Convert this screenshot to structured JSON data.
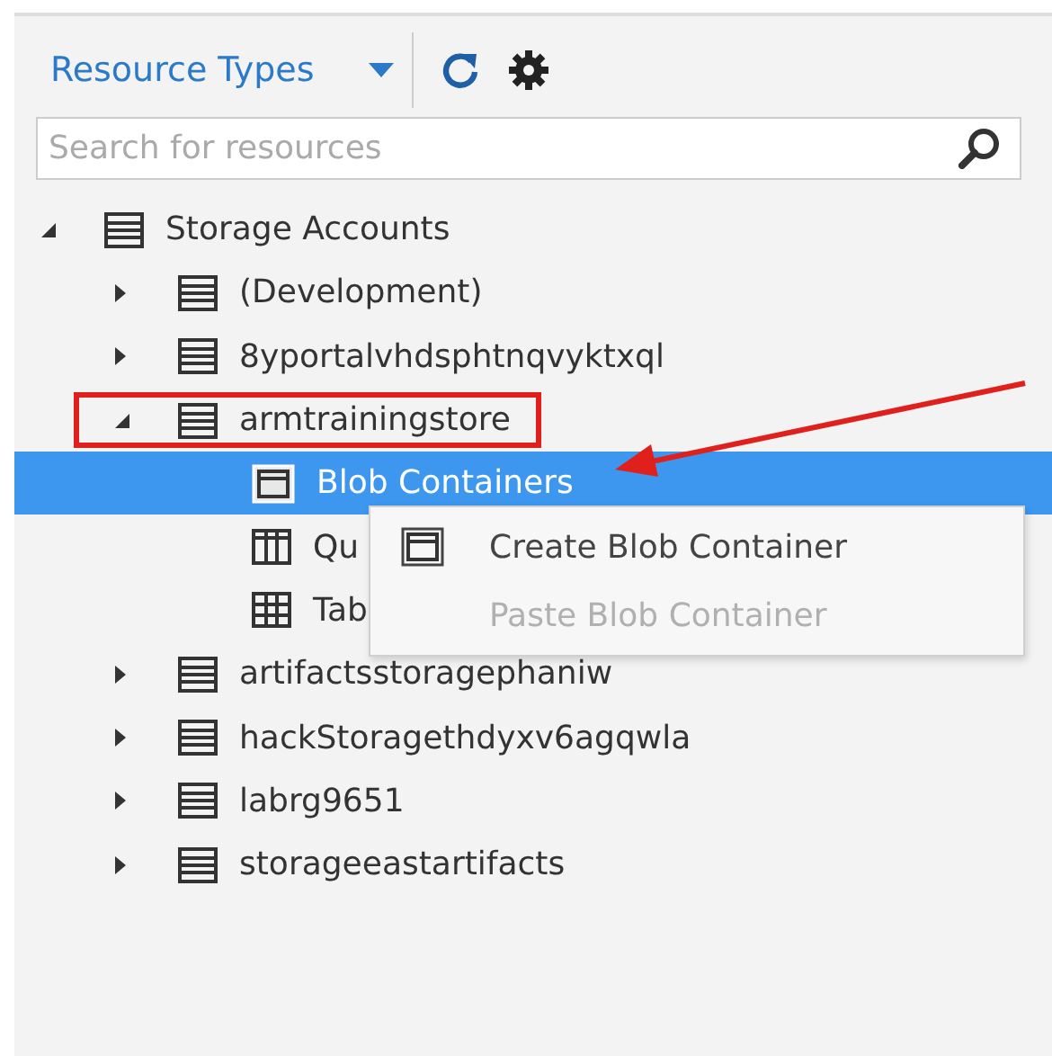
{
  "toolbar": {
    "dropdown": "Resource Types"
  },
  "search": {
    "placeholder": "Search for resources"
  },
  "tree": [
    {
      "label": "Storage Accounts",
      "kind": "account",
      "expanded": true,
      "selected": false,
      "children": [
        {
          "label": "(Development)",
          "kind": "account",
          "expanded": false,
          "selected": false
        },
        {
          "label": "8yportalvhdsphtnqvyktxql",
          "kind": "account",
          "expanded": false,
          "selected": false
        },
        {
          "label": "armtrainingstore",
          "kind": "account",
          "expanded": true,
          "selected": false,
          "callout": true,
          "children": [
            {
              "label": "Blob Containers",
              "kind": "blob",
              "selected": true
            },
            {
              "label": "Qu",
              "kind": "queue",
              "selected": false
            },
            {
              "label": "Tab",
              "kind": "table",
              "selected": false
            }
          ]
        },
        {
          "label": "artifactsstoragephaniw",
          "kind": "account",
          "expanded": false,
          "selected": false
        },
        {
          "label": "hackStoragethdyxv6agqwla",
          "kind": "account",
          "expanded": false,
          "selected": false
        },
        {
          "label": "labrg9651",
          "kind": "account",
          "expanded": false,
          "selected": false
        },
        {
          "label": "storageeastartifacts",
          "kind": "account",
          "expanded": false,
          "selected": false
        }
      ]
    }
  ],
  "context_menu": [
    {
      "label": "Create Blob Container",
      "kind": "blob",
      "disabled": false
    },
    {
      "label": "Paste Blob Container",
      "kind": "plain",
      "disabled": true
    }
  ]
}
